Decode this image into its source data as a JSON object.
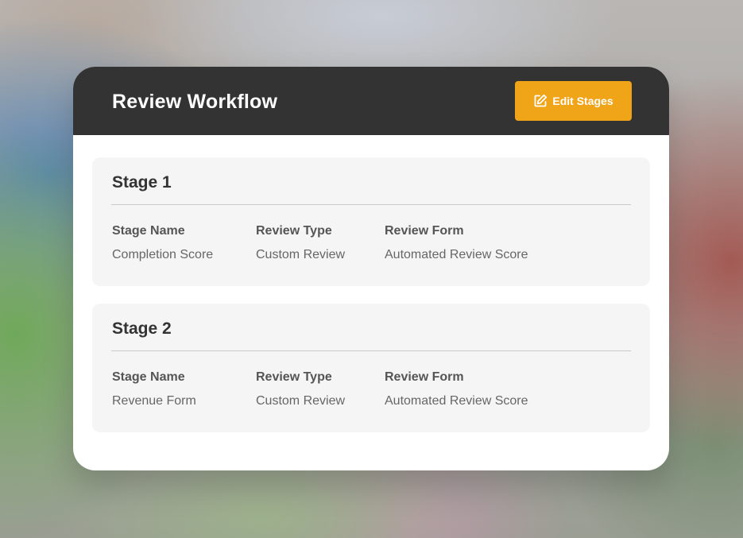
{
  "card": {
    "title": "Review Workflow",
    "edit_button": {
      "label": "Edit Stages",
      "icon": "edit-icon"
    }
  },
  "stages": [
    {
      "title": "Stage 1",
      "fields": [
        {
          "label": "Stage Name",
          "value": "Completion Score"
        },
        {
          "label": "Review Type",
          "value": "Custom Review"
        },
        {
          "label": "Review Form",
          "value": "Automated Review Score"
        }
      ]
    },
    {
      "title": "Stage 2",
      "fields": [
        {
          "label": "Stage Name",
          "value": "Revenue Form"
        },
        {
          "label": "Review Type",
          "value": "Custom Review"
        },
        {
          "label": "Review Form",
          "value": "Automated Review Score"
        }
      ]
    }
  ],
  "colors": {
    "header_bg": "#333333",
    "accent": "#f0a418",
    "stage_bg": "#f5f5f5"
  }
}
